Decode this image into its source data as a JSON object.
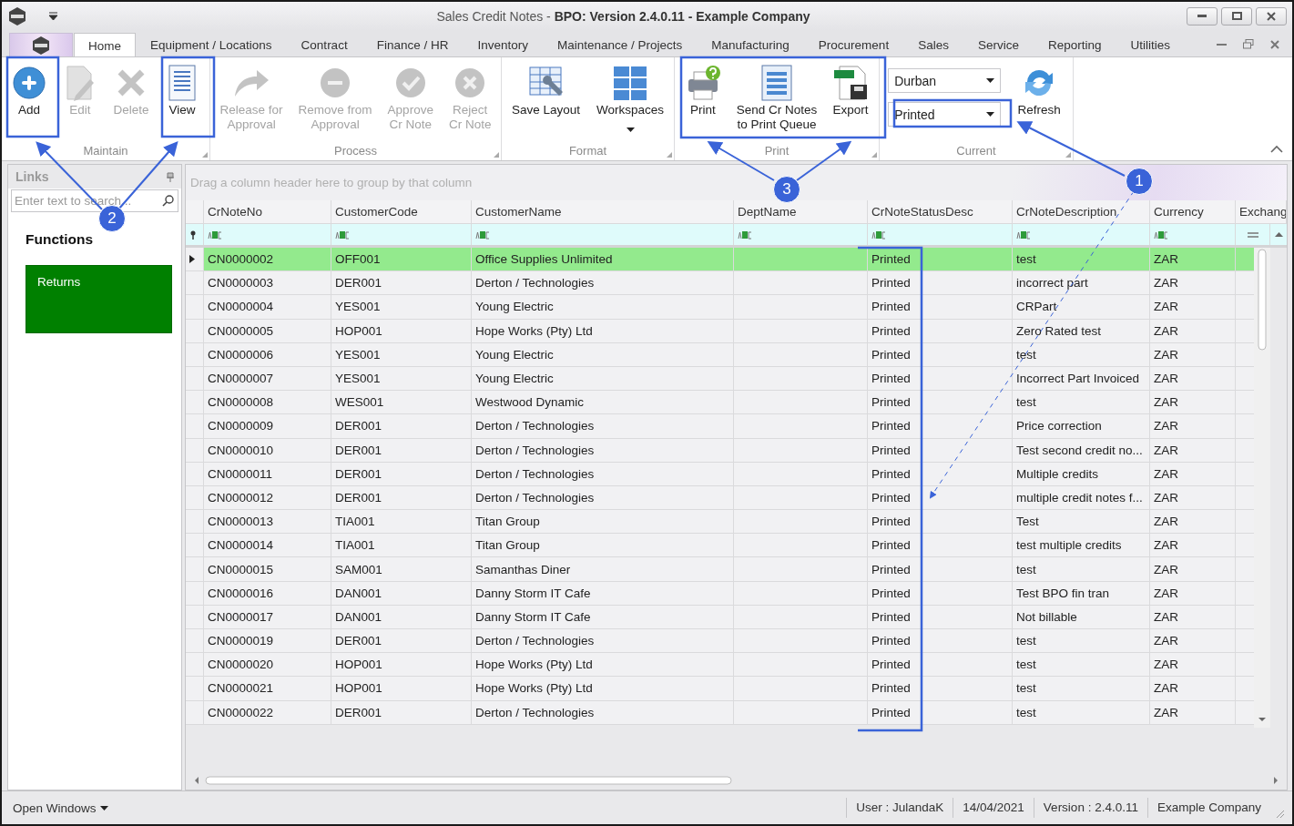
{
  "window": {
    "title": "Sales Credit Notes - **BPO: Version 2.4.0.11 - Example Company**"
  },
  "tabs": [
    {
      "label": "Home",
      "selected": true
    },
    {
      "label": "Equipment / Locations",
      "selected": false
    },
    {
      "label": "Contract",
      "selected": false
    },
    {
      "label": "Finance / HR",
      "selected": false
    },
    {
      "label": "Inventory",
      "selected": false
    },
    {
      "label": "Maintenance / Projects",
      "selected": false
    },
    {
      "label": "Manufacturing",
      "selected": false
    },
    {
      "label": "Procurement",
      "selected": false
    },
    {
      "label": "Sales",
      "selected": false
    },
    {
      "label": "Service",
      "selected": false
    },
    {
      "label": "Reporting",
      "selected": false
    },
    {
      "label": "Utilities",
      "selected": false
    }
  ],
  "ribbon": {
    "groups": [
      {
        "label": "Maintain",
        "items": [
          {
            "kind": "button",
            "label": "Add",
            "disabled": false
          },
          {
            "kind": "button",
            "label": "Edit",
            "disabled": true
          },
          {
            "kind": "button",
            "label": "Delete",
            "disabled": true
          },
          {
            "kind": "button",
            "label": "View",
            "disabled": false
          }
        ]
      },
      {
        "label": "Process",
        "items": [
          {
            "kind": "button",
            "label": "Release for\nApproval",
            "disabled": true
          },
          {
            "kind": "button",
            "label": "Remove from\nApproval",
            "disabled": true
          },
          {
            "kind": "button",
            "label": "Approve\nCr Note",
            "disabled": true
          },
          {
            "kind": "button",
            "label": "Reject\nCr Note",
            "disabled": true
          }
        ]
      },
      {
        "label": "Format",
        "items": [
          {
            "kind": "button",
            "label": "Save Layout",
            "disabled": false
          },
          {
            "kind": "menu",
            "label": "Workspaces",
            "disabled": false
          }
        ]
      },
      {
        "label": "Print",
        "items": [
          {
            "kind": "button",
            "label": "Print",
            "disabled": false
          },
          {
            "kind": "button",
            "label": "Send Cr Notes\nto Print Queue",
            "disabled": false
          },
          {
            "kind": "button",
            "label": "Export",
            "disabled": false
          }
        ]
      },
      {
        "label": "Current",
        "items": [
          {
            "kind": "combo",
            "value": "Durban"
          },
          {
            "kind": "combo",
            "value": "Printed"
          },
          {
            "kind": "button",
            "label": "Refresh",
            "disabled": false
          }
        ]
      }
    ]
  },
  "links_panel": {
    "title": "Links",
    "search": {
      "placeholder": "Enter text to search..."
    },
    "section": "Functions",
    "tiles": [
      {
        "label": "Returns"
      }
    ]
  },
  "grid": {
    "group_hint": "Drag a column header here to group by that column",
    "columns": [
      {
        "label": "CrNoteNo",
        "kind": "text"
      },
      {
        "label": "CustomerCode",
        "kind": "text"
      },
      {
        "label": "CustomerName",
        "kind": "text"
      },
      {
        "label": "DeptName",
        "kind": "text"
      },
      {
        "label": "CrNoteStatusDesc",
        "kind": "text"
      },
      {
        "label": "CrNoteDescription",
        "kind": "text"
      },
      {
        "label": "Currency",
        "kind": "text"
      },
      {
        "label": "Exchang",
        "kind": "number"
      }
    ],
    "rows": [
      {
        "cells": [
          "CN0000002",
          "OFF001",
          "Office Supplies Unlimited",
          null,
          "Printed",
          "test",
          "ZAR",
          null
        ],
        "selected": true
      },
      {
        "cells": [
          "CN0000003",
          "DER001",
          "Derton / Technologies",
          null,
          "Printed",
          "incorrect part",
          "ZAR",
          null
        ],
        "selected": false
      },
      {
        "cells": [
          "CN0000004",
          "YES001",
          "Young Electric",
          null,
          "Printed",
          "CRPart",
          "ZAR",
          null
        ],
        "selected": false
      },
      {
        "cells": [
          "CN0000005",
          "HOP001",
          "Hope Works (Pty) Ltd",
          null,
          "Printed",
          "Zero Rated test",
          "ZAR",
          null
        ],
        "selected": false
      },
      {
        "cells": [
          "CN0000006",
          "YES001",
          "Young Electric",
          null,
          "Printed",
          "test",
          "ZAR",
          null
        ],
        "selected": false
      },
      {
        "cells": [
          "CN0000007",
          "YES001",
          "Young Electric",
          null,
          "Printed",
          "Incorrect Part Invoiced",
          "ZAR",
          null
        ],
        "selected": false
      },
      {
        "cells": [
          "CN0000008",
          "WES001",
          "Westwood Dynamic",
          null,
          "Printed",
          "test",
          "ZAR",
          null
        ],
        "selected": false
      },
      {
        "cells": [
          "CN0000009",
          "DER001",
          "Derton / Technologies",
          null,
          "Printed",
          "Price correction",
          "ZAR",
          null
        ],
        "selected": false
      },
      {
        "cells": [
          "CN0000010",
          "DER001",
          "Derton / Technologies",
          null,
          "Printed",
          "Test second credit no...",
          "ZAR",
          null
        ],
        "selected": false
      },
      {
        "cells": [
          "CN0000011",
          "DER001",
          "Derton / Technologies",
          null,
          "Printed",
          "Multiple credits",
          "ZAR",
          null
        ],
        "selected": false
      },
      {
        "cells": [
          "CN0000012",
          "DER001",
          "Derton / Technologies",
          null,
          "Printed",
          "multiple credit notes f...",
          "ZAR",
          null
        ],
        "selected": false
      },
      {
        "cells": [
          "CN0000013",
          "TIA001",
          "Titan Group",
          null,
          "Printed",
          "Test",
          "ZAR",
          null
        ],
        "selected": false
      },
      {
        "cells": [
          "CN0000014",
          "TIA001",
          "Titan Group",
          null,
          "Printed",
          "test multiple credits",
          "ZAR",
          null
        ],
        "selected": false
      },
      {
        "cells": [
          "CN0000015",
          "SAM001",
          "Samanthas Diner",
          null,
          "Printed",
          "test",
          "ZAR",
          null
        ],
        "selected": false
      },
      {
        "cells": [
          "CN0000016",
          "DAN001",
          "Danny Storm IT Cafe",
          null,
          "Printed",
          "Test BPO fin tran",
          "ZAR",
          null
        ],
        "selected": false
      },
      {
        "cells": [
          "CN0000017",
          "DAN001",
          "Danny Storm IT Cafe",
          null,
          "Printed",
          "Not billable",
          "ZAR",
          null
        ],
        "selected": false
      },
      {
        "cells": [
          "CN0000019",
          "DER001",
          "Derton / Technologies",
          null,
          "Printed",
          "test",
          "ZAR",
          null
        ],
        "selected": false
      },
      {
        "cells": [
          "CN0000020",
          "HOP001",
          "Hope Works (Pty) Ltd",
          null,
          "Printed",
          "test",
          "ZAR",
          null
        ],
        "selected": false
      },
      {
        "cells": [
          "CN0000021",
          "HOP001",
          "Hope Works (Pty) Ltd",
          null,
          "Printed",
          "test",
          "ZAR",
          null
        ],
        "selected": false
      },
      {
        "cells": [
          "CN0000022",
          "DER001",
          "Derton / Technologies",
          null,
          "Printed",
          "test",
          "ZAR",
          null
        ],
        "selected": false
      }
    ]
  },
  "status_bar": {
    "open_windows": "Open Windows",
    "user": "User : JulandaK",
    "date": "14/04/2021",
    "version": "Version : 2.4.0.11",
    "company": "Example Company"
  },
  "callouts": [
    {
      "number": "1"
    },
    {
      "number": "2"
    },
    {
      "number": "3"
    }
  ]
}
